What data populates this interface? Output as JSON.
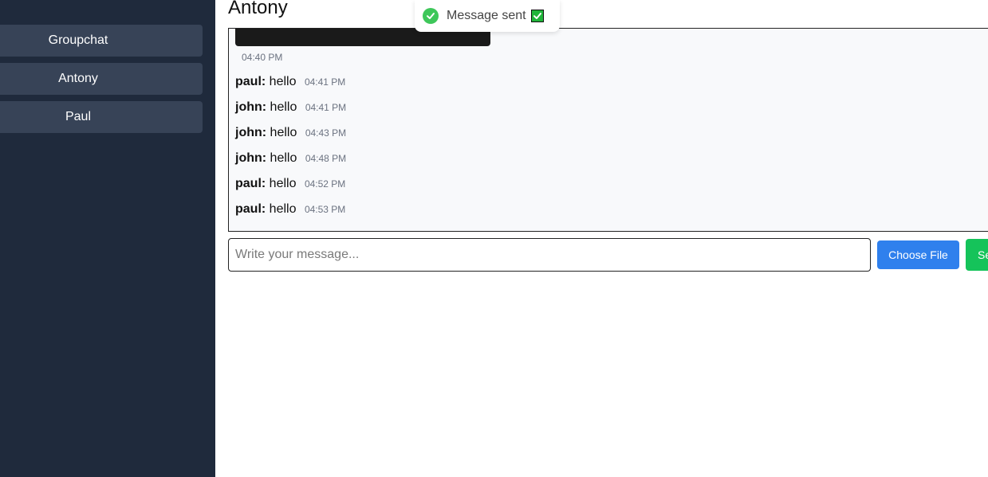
{
  "sidebar": {
    "items": [
      {
        "label": "Groupchat"
      },
      {
        "label": "Antony"
      },
      {
        "label": "Paul"
      }
    ]
  },
  "chat": {
    "title": "Antony",
    "image_time": "04:40 PM",
    "messages": [
      {
        "sender": "paul:",
        "text": "hello",
        "time": "04:41 PM"
      },
      {
        "sender": "john:",
        "text": "hello",
        "time": "04:41 PM"
      },
      {
        "sender": "john:",
        "text": "hello",
        "time": "04:43 PM"
      },
      {
        "sender": "john:",
        "text": "hello",
        "time": "04:48 PM"
      },
      {
        "sender": "paul:",
        "text": "hello",
        "time": "04:52 PM"
      },
      {
        "sender": "paul:",
        "text": "hello",
        "time": "04:53 PM"
      }
    ]
  },
  "composer": {
    "placeholder": "Write your message...",
    "value": "",
    "file_label": "Choose File",
    "send_label": "Se"
  },
  "toast": {
    "text": "Message sent",
    "icon": "check-circle-icon",
    "emoji_icon": "check-mark-button-icon"
  },
  "colors": {
    "sidebar_bg": "#1f2a3c",
    "sidebar_item_bg": "#374357",
    "file_button": "#2f80ed",
    "send_button": "#15c35a",
    "success": "#3ec75a"
  }
}
